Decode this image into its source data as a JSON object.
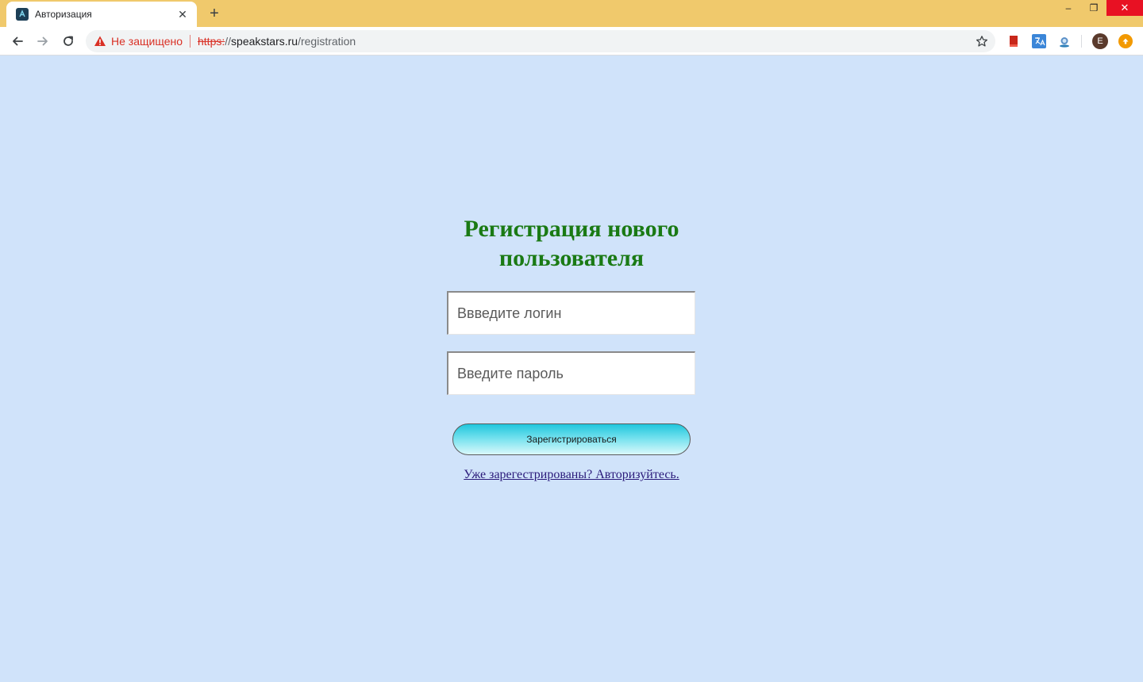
{
  "browser": {
    "tab": {
      "title": "Авторизация",
      "close_glyph": "✕",
      "favicon": "speakstars-logo"
    },
    "new_tab_glyph": "+",
    "window_controls": {
      "minimize": "–",
      "restore": "❐",
      "close": "✕"
    },
    "address_bar": {
      "security_label": "Не защищено",
      "url_scheme": "https:",
      "url_slashes": "//",
      "url_host": "speakstars.ru",
      "url_path": "/registration"
    },
    "profile_initial": "E",
    "extensions": [
      "bookmark-red-icon",
      "translate-icon",
      "globe-extension-icon"
    ]
  },
  "page": {
    "heading": "Регистрация нового пользователя",
    "login_placeholder": "Ввведите логин",
    "password_placeholder": "Введите пароль",
    "submit_label": "Зарегистрироваться",
    "login_link": "Уже зарегестрированы? Авторизуйтесь."
  },
  "colors": {
    "page_background": "#d0e3fa",
    "titlebar": "#f0c96c",
    "heading": "#1a7a14",
    "button_gradient_top": "#1fc6dd",
    "link": "#2a1a7a"
  }
}
